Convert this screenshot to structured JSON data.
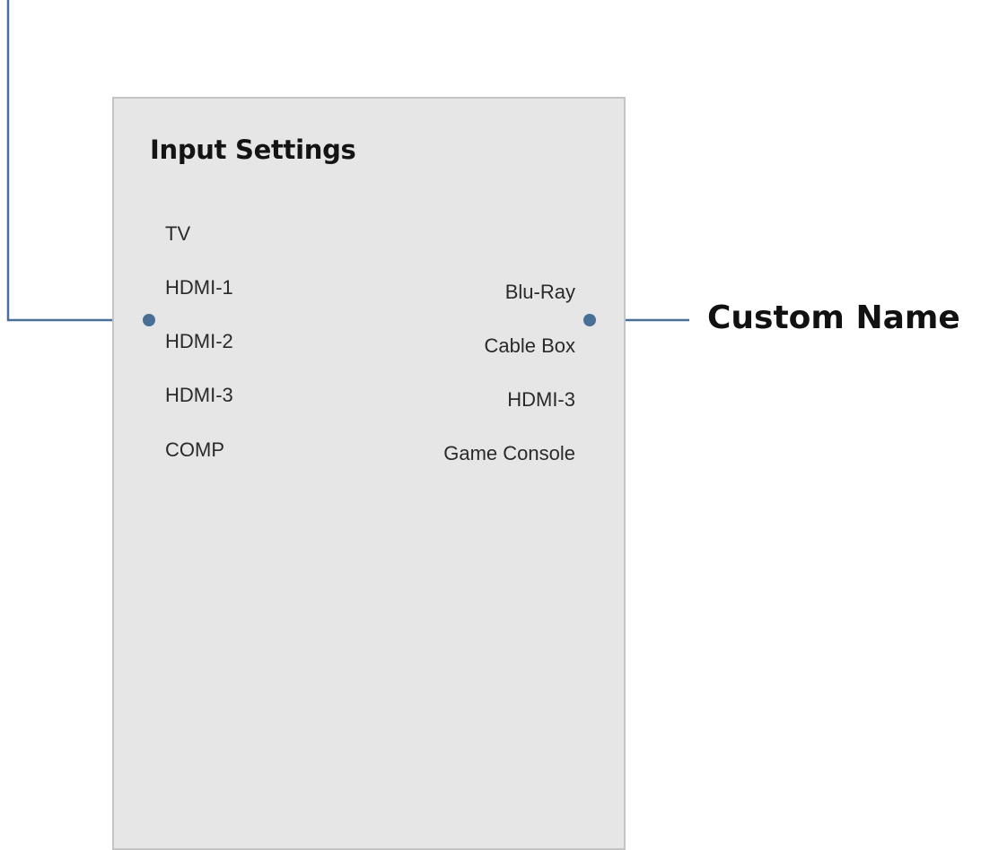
{
  "panel": {
    "title": "Input Settings",
    "inputs": [
      "TV",
      "HDMI-1",
      "HDMI-2",
      "HDMI-3",
      "COMP"
    ],
    "custom_names": [
      "Blu-Ray",
      "Cable Box",
      "HDMI-3",
      "Game Console"
    ]
  },
  "callout": {
    "label": "Custom Name",
    "color": "#4a6f96"
  }
}
